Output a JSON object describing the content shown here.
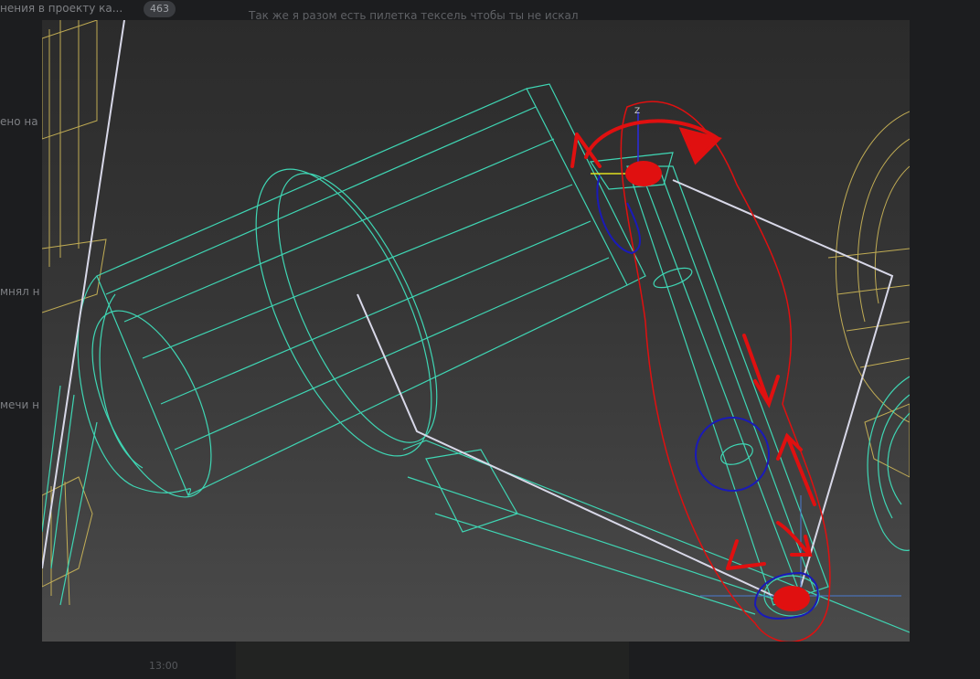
{
  "chat": {
    "header_fragment": "нения в проекту ка...",
    "unread_count": "463",
    "message_snippet": "Так же я разом есть пилетка тексель чтобы ты не искал",
    "sidebar_fragments": [
      "ено на",
      "мнял н",
      "мечи н"
    ],
    "timestamp": "13:00"
  },
  "viewport": {
    "gizmo_axis_label": "Z",
    "colors": {
      "wire_cyan": "#3fd6b4",
      "wire_yellow": "#d9c15a",
      "wire_white": "#d8d8e8",
      "annotation_red": "#e01010",
      "annotation_blue": "#1a1ab8"
    }
  }
}
